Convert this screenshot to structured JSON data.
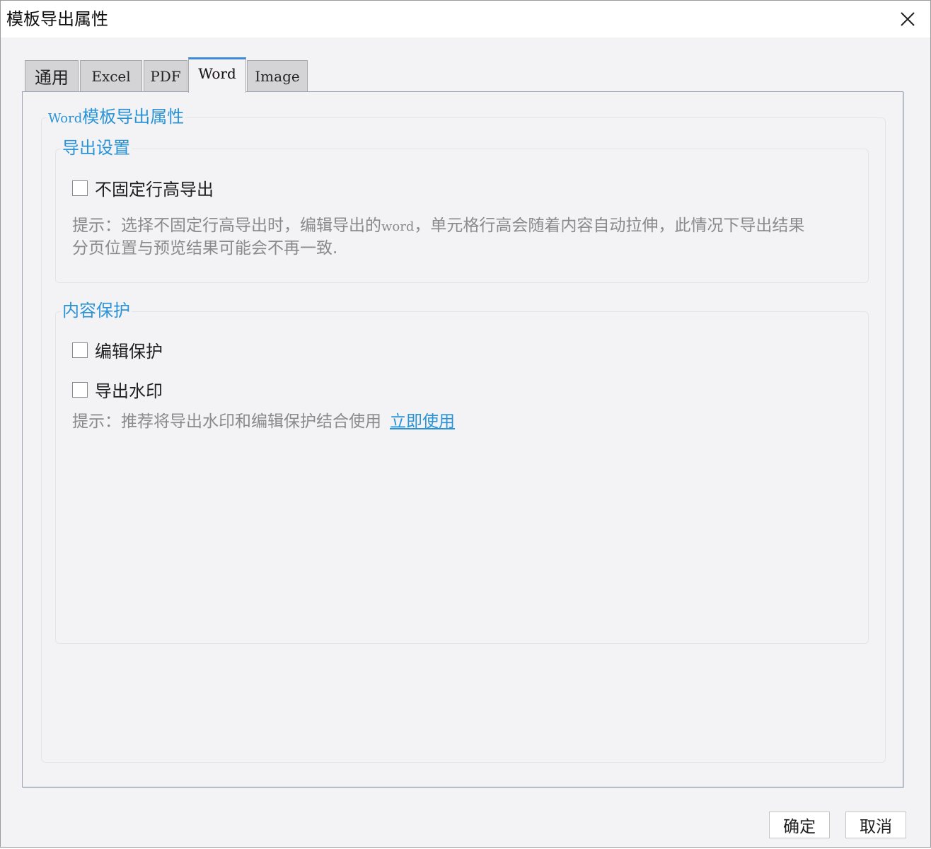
{
  "window": {
    "title": "模板导出属性"
  },
  "tabs": [
    {
      "label": "通用"
    },
    {
      "label": "Excel"
    },
    {
      "label": "PDF"
    },
    {
      "label": "Word",
      "active": true
    },
    {
      "label": "Image"
    }
  ],
  "word_panel": {
    "legend_prefix": "Word",
    "legend_suffix": "模板导出属性",
    "export_settings": {
      "legend": "导出设置",
      "no_fixed_row_height_label": "不固定行高导出",
      "no_fixed_row_height_checked": false,
      "hint_prefix": "提示：选择不固定行高导出时，编辑导出的",
      "hint_word": "word",
      "hint_suffix": "，单元格行高会随着内容自动拉伸，此情况下导出结果",
      "hint_line2": "分页位置与预览结果可能会不再一致."
    },
    "content_protection": {
      "legend": "内容保护",
      "edit_protection_label": "编辑保护",
      "edit_protection_checked": false,
      "export_watermark_label": "导出水印",
      "export_watermark_checked": false,
      "hint_text": "提示：推荐将导出水印和编辑保护结合使用",
      "hint_link": "立即使用"
    }
  },
  "buttons": {
    "ok_label": "确定",
    "cancel_label": "取消"
  },
  "colors": {
    "accent": "#2a93d5",
    "active_tab_indicator": "#3b8bd9",
    "background": "#f3f3f5"
  }
}
